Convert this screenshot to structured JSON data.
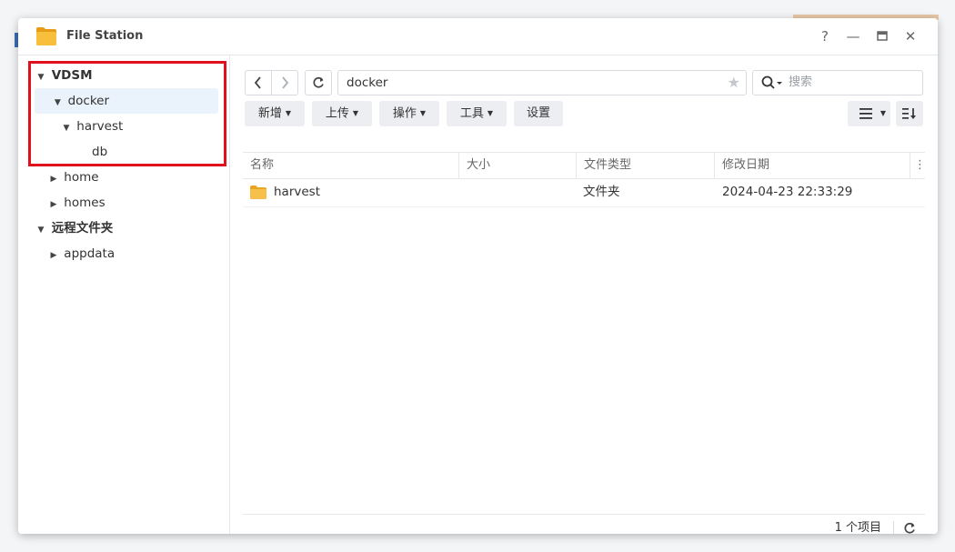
{
  "window": {
    "title": "File Station",
    "controls": {
      "help": "?",
      "minimize": "—",
      "maximize": "▭",
      "close": "✕"
    }
  },
  "sidebar": {
    "items": [
      {
        "label": "VDSM",
        "level": 0,
        "expanded": true,
        "bold": true
      },
      {
        "label": "docker",
        "level": 1,
        "expanded": true,
        "selected": true
      },
      {
        "label": "harvest",
        "level": 2,
        "expanded": true
      },
      {
        "label": "db",
        "level": 3
      },
      {
        "label": "home",
        "level": 1,
        "expanded": false
      },
      {
        "label": "homes",
        "level": 1,
        "expanded": false
      },
      {
        "label": "远程文件夹",
        "level": 0,
        "expanded": true,
        "bold": true
      },
      {
        "label": "appdata",
        "level": 1,
        "expanded": false
      }
    ]
  },
  "toolbar": {
    "path": "docker",
    "search_placeholder": "搜索",
    "buttons": {
      "new": "新增",
      "upload": "上传",
      "action": "操作",
      "tools": "工具",
      "settings": "设置"
    }
  },
  "table": {
    "columns": [
      "名称",
      "大小",
      "文件类型",
      "修改日期"
    ],
    "rows": [
      {
        "name": "harvest",
        "size": "",
        "type": "文件夹",
        "modified": "2024-04-23 22:33:29"
      }
    ]
  },
  "footer": {
    "item_count": "1 个项目"
  },
  "colors": {
    "highlight": "#e0101d",
    "folder": "#f2b531",
    "selected_bg": "#eaf2fc"
  }
}
